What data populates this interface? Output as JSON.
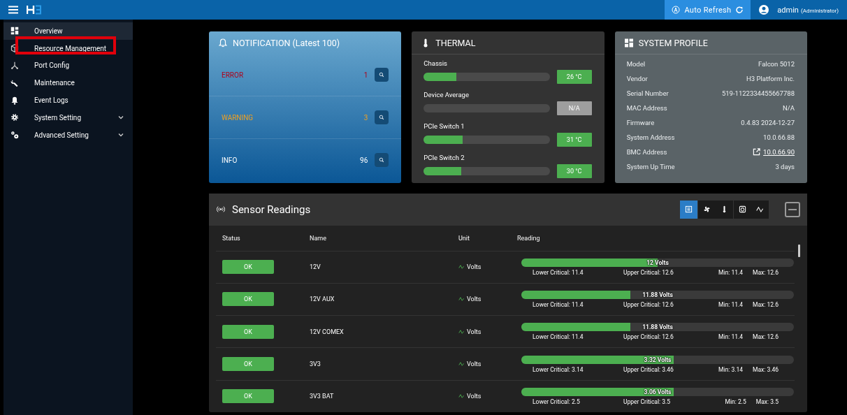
{
  "topbar": {
    "auto_refresh": "Auto Refresh",
    "user": "admin",
    "role": "(Administrator)"
  },
  "sidebar": {
    "items": [
      {
        "label": "Overview",
        "selected": true,
        "highlighted": false,
        "expandable": false
      },
      {
        "label": "Resource Management",
        "selected": false,
        "highlighted": true,
        "expandable": false
      },
      {
        "label": "Port Config",
        "selected": false,
        "highlighted": false,
        "expandable": false
      },
      {
        "label": "Maintenance",
        "selected": false,
        "highlighted": false,
        "expandable": false
      },
      {
        "label": "Event Logs",
        "selected": false,
        "highlighted": false,
        "expandable": false
      },
      {
        "label": "System Setting",
        "selected": false,
        "highlighted": false,
        "expandable": true
      },
      {
        "label": "Advanced Setting",
        "selected": false,
        "highlighted": false,
        "expandable": true
      }
    ]
  },
  "notification": {
    "title": "NOTIFICATION (Latest 100)",
    "rows": [
      {
        "kind": "error",
        "label": "ERROR",
        "count": "1"
      },
      {
        "kind": "warning",
        "label": "WARNING",
        "count": "3"
      },
      {
        "kind": "info",
        "label": "INFO",
        "count": "96"
      }
    ]
  },
  "thermal": {
    "title": "THERMAL",
    "items": [
      {
        "label": "Chassis",
        "level": 0.26,
        "reading": "26 °C",
        "available": true
      },
      {
        "label": "Device Average",
        "level": 0,
        "reading": "N/A",
        "available": false
      },
      {
        "label": "PCIe Switch 1",
        "level": 0.31,
        "reading": "31 °C",
        "available": true
      },
      {
        "label": "PCIe Switch 2",
        "level": 0.3,
        "reading": "30 °C",
        "available": true
      }
    ]
  },
  "system_profile": {
    "title": "SYSTEM PROFILE",
    "rows": [
      {
        "label": "Model",
        "value": "Falcon 5012",
        "kind": "text"
      },
      {
        "label": "Vendor",
        "value": "H3 Platform Inc.",
        "kind": "text"
      },
      {
        "label": "Serial Number",
        "value": "519-1122334455667788",
        "kind": "text"
      },
      {
        "label": "MAC Address",
        "value": "N/A",
        "kind": "text"
      },
      {
        "label": "Firmware",
        "value": "0.4.83 2024-12-27",
        "kind": "text"
      },
      {
        "label": "System Address",
        "value": "10.0.66.88",
        "kind": "text"
      },
      {
        "label": "BMC Address",
        "value": "10.0.66.90",
        "kind": "link"
      },
      {
        "label": "System Up Time",
        "value": "3 days",
        "kind": "text"
      }
    ]
  },
  "sensor_readings": {
    "title": "Sensor Readings",
    "filters": [
      {
        "selected": true
      },
      {
        "selected": false
      },
      {
        "selected": false
      },
      {
        "selected": false
      },
      {
        "selected": false
      }
    ],
    "columns": [
      "Status",
      "Name",
      "Unit",
      "Reading"
    ],
    "rows": [
      {
        "status": "OK",
        "name": "12V",
        "unit": "Volts",
        "reading": "12 Volts",
        "level": 0.5,
        "lower_critical": "Lower Critical: 11.4",
        "upper_critical": "Upper Critical: 12.6",
        "min": "Min: 11.4",
        "max": "Max: 12.6"
      },
      {
        "status": "OK",
        "name": "12V AUX",
        "unit": "Volts",
        "reading": "11.88 Volts",
        "level": 0.4,
        "lower_critical": "Lower Critical: 11.4",
        "upper_critical": "Upper Critical: 12.6",
        "min": "Min: 11.4",
        "max": "Max: 12.6"
      },
      {
        "status": "OK",
        "name": "12V COMEX",
        "unit": "Volts",
        "reading": "11.88 Volts",
        "level": 0.4,
        "lower_critical": "Lower Critical: 11.4",
        "upper_critical": "Upper Critical: 12.6",
        "min": "Min: 11.4",
        "max": "Max: 12.6"
      },
      {
        "status": "OK",
        "name": "3V3",
        "unit": "Volts",
        "reading": "3.32 Volts",
        "level": 0.56,
        "lower_critical": "Lower Critical: 3.14",
        "upper_critical": "Upper Critical: 3.46",
        "min": "Min: 3.14",
        "max": "Max: 3.46"
      },
      {
        "status": "OK",
        "name": "3V3 BAT",
        "unit": "Volts",
        "reading": "3.06 Volts",
        "level": 0.56,
        "lower_critical": "Lower Critical: 2.5",
        "upper_critical": "Upper Critical: 3.5",
        "min": "Min: 2.5",
        "max": "Max: 3.5"
      }
    ]
  }
}
